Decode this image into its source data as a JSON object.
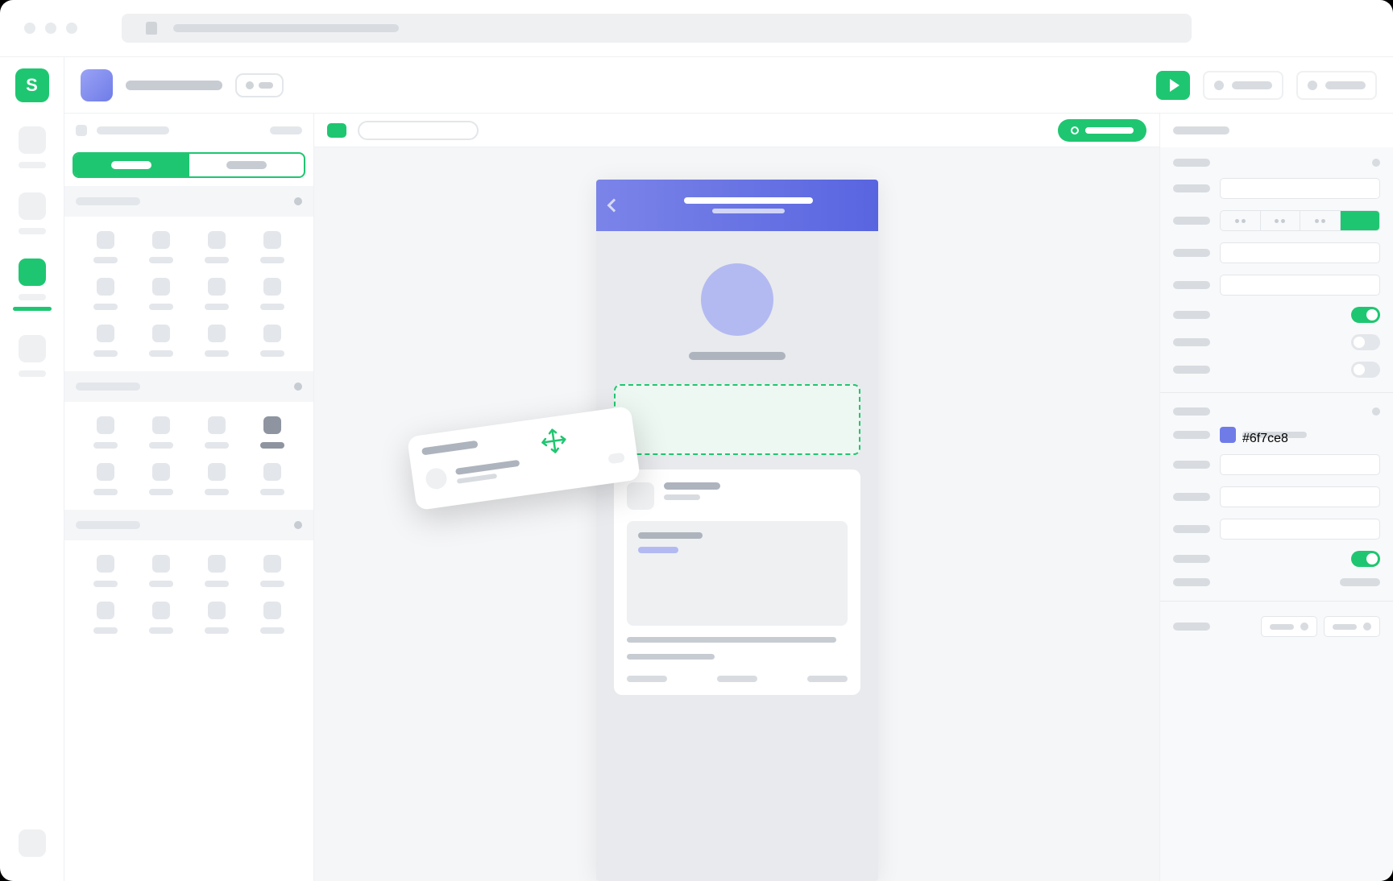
{
  "browser": {
    "url_placeholder": ""
  },
  "rail": {
    "logo_letter": "S",
    "items": [
      {
        "name": "nav-1",
        "active": false
      },
      {
        "name": "nav-2",
        "active": false
      },
      {
        "name": "nav-3",
        "active": true
      },
      {
        "name": "nav-4",
        "active": false
      }
    ]
  },
  "topbar": {
    "project_name": "",
    "play_label": "",
    "action_1": "",
    "action_2": ""
  },
  "left_panel": {
    "tab_active": "",
    "tab_inactive": "",
    "sections": [
      {
        "title": "",
        "item_count": 16
      },
      {
        "title": "",
        "item_count": 8
      },
      {
        "title": "",
        "item_count": 8
      }
    ]
  },
  "canvas": {
    "toolbar": {
      "badge": "",
      "search": "",
      "status_button": ""
    },
    "device": {
      "header_title": "",
      "header_subtitle": "",
      "profile_name": "",
      "card": {
        "title": "",
        "subtitle": "",
        "body_label": "",
        "body_tag": "",
        "footer_text": ""
      }
    },
    "drag_element": {
      "title": "",
      "name": "",
      "sub": ""
    }
  },
  "right_panel": {
    "header": "",
    "section_1_title": "",
    "section_2_title": "",
    "toggles": {
      "t1": true,
      "t2": false,
      "t3": false,
      "t4": true
    },
    "color_value": "#6f7ce8",
    "properties": [
      {
        "label": "",
        "value": ""
      },
      {
        "label": "",
        "value": ""
      },
      {
        "label": "",
        "value": ""
      },
      {
        "label": "",
        "value": ""
      }
    ]
  },
  "colors": {
    "accent": "#1fc671",
    "primary": "#6f7ce8"
  }
}
